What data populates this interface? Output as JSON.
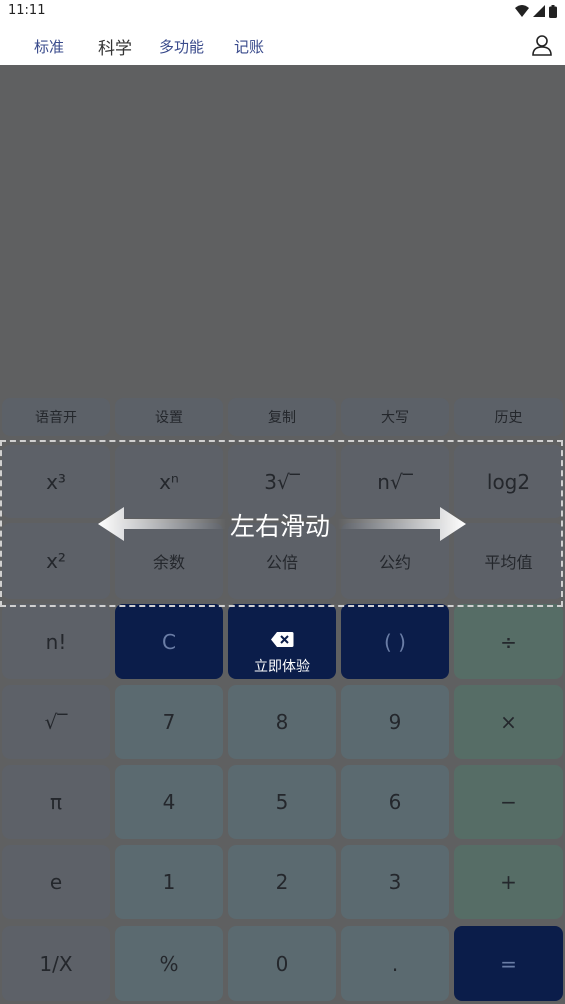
{
  "status_bar": {
    "time": "11:11"
  },
  "nav": {
    "tabs": [
      {
        "label": "标准"
      },
      {
        "label": "科学"
      },
      {
        "label": "多功能"
      },
      {
        "label": "记账"
      }
    ]
  },
  "top_row": [
    "语音开",
    "设置",
    "复制",
    "大写",
    "历史"
  ],
  "rows": [
    [
      "x³",
      "xⁿ",
      "3√‾",
      "n√‾",
      "log2"
    ],
    [
      "x²",
      "余数",
      "公倍",
      "公约",
      "平均值"
    ],
    [
      "n!",
      "C",
      "",
      "( )",
      "÷"
    ],
    [
      "√‾",
      "7",
      "8",
      "9",
      "×"
    ],
    [
      "π",
      "4",
      "5",
      "6",
      "−"
    ],
    [
      "e",
      "1",
      "2",
      "3",
      "+"
    ],
    [
      "1/X",
      "%",
      "0",
      ".",
      "="
    ]
  ],
  "overlay": {
    "swipe_hint": "左右滑动",
    "trial_label": "立即体验"
  },
  "icons": {
    "wifi": "wifi-icon",
    "signal": "signal-icon",
    "battery": "battery-icon",
    "user": "user-icon",
    "backspace": "backspace-icon",
    "left_arrow": "left-arrow-icon",
    "right_arrow": "right-arrow-icon"
  },
  "colors": {
    "navy": "#0b1d4a",
    "dim": "#5f6061",
    "white": "#ffffff"
  }
}
